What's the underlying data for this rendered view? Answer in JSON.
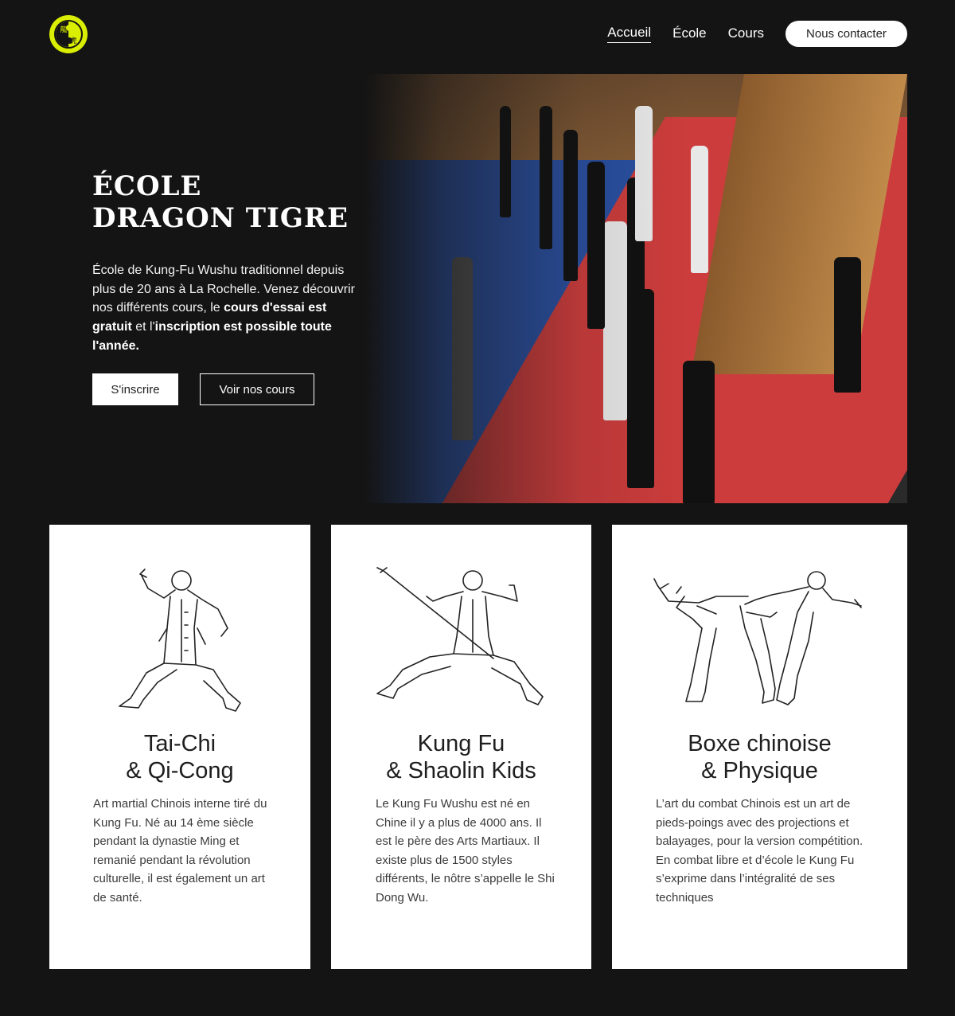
{
  "header": {
    "logo_glyphs": [
      "龍",
      "虎"
    ],
    "nav": [
      {
        "label": "Accueil",
        "active": true
      },
      {
        "label": "École",
        "active": false
      },
      {
        "label": "Cours",
        "active": false
      }
    ],
    "contact_label": "Nous contacter"
  },
  "hero": {
    "title_line1": "École",
    "title_line2": "Dragon Tigre",
    "desc_part1": "École de Kung-Fu Wushu traditionnel depuis plus de 20 ans à La Rochelle. Venez découvrir nos différents cours, le ",
    "desc_bold1": "cours d'essai est gratuit",
    "desc_part2": " et l'",
    "desc_bold2": "inscription est possible toute l'année",
    "desc_part3": ".",
    "btn_primary": "S'inscrire",
    "btn_secondary": "Voir nos cours"
  },
  "cards": [
    {
      "title_line1": "Tai-Chi",
      "title_line2": "& Qi-Cong",
      "text": "Art martial Chinois interne tiré du Kung Fu. Né au 14 ème siècle pendant la dynastie Ming et remanié pendant la révolution culturelle, il est également un art de santé."
    },
    {
      "title_line1": "Kung Fu",
      "title_line2": "& Shaolin Kids",
      "text": "Le Kung Fu Wushu est né en Chine il y a plus de 4000 ans. Il est le père des Arts Martiaux. Il existe plus de 1500 styles différents, le nôtre s’appelle le Shi Dong Wu."
    },
    {
      "title_line1": "Boxe chinoise",
      "title_line2": "& Physique",
      "text": "L’art du combat Chinois est un art de pieds-poings avec des projections et balayages, pour la version compétition. En combat libre et d’école le Kung Fu s’exprime dans l’intégralité de ses techniques"
    }
  ],
  "colors": {
    "background": "#141414",
    "logo_accent": "#d9ee00",
    "card_bg": "#ffffff"
  }
}
